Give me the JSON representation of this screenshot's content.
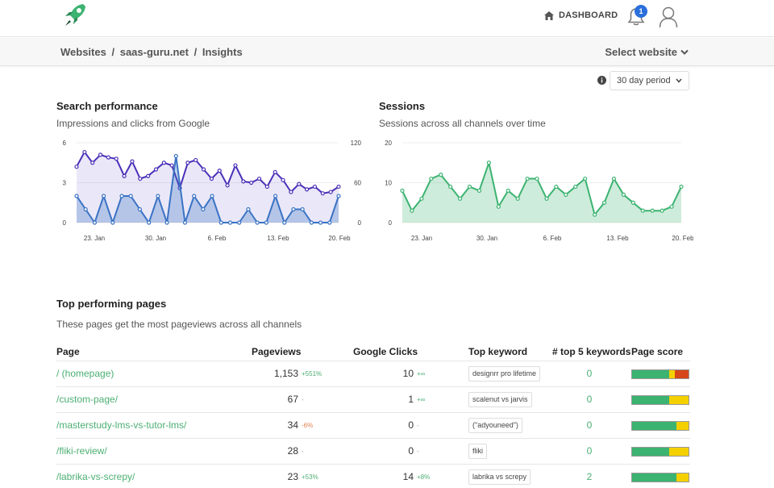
{
  "header": {
    "dashboard_label": "DASHBOARD",
    "notification_count": "1",
    "brand_color": "#3cb371"
  },
  "breadcrumb": {
    "items": [
      "Websites",
      "/",
      "saas-guru.net",
      "/",
      "Insights"
    ],
    "select_label": "Select website"
  },
  "period": {
    "selected": "30 day period"
  },
  "search_performance": {
    "title": "Search performance",
    "subtitle": "Impressions and clicks from Google"
  },
  "sessions": {
    "title": "Sessions",
    "subtitle": "Sessions across all channels over time"
  },
  "chart_data": [
    {
      "type": "line",
      "left_axis_ticks": [
        "6",
        "3",
        "0"
      ],
      "right_axis_ticks": [
        "120",
        "60",
        "0"
      ],
      "x_ticks": [
        "23. Jan",
        "30. Jan",
        "6. Feb",
        "13. Feb",
        "20. Feb"
      ],
      "ylim_left": [
        0,
        6
      ],
      "ylim_right": [
        0,
        120
      ],
      "series": [
        {
          "color": "#4b2fb8",
          "axis": "right",
          "values": [
            84,
            106,
            90,
            102,
            98,
            96,
            70,
            92,
            66,
            70,
            80,
            90,
            86,
            52,
            90,
            94,
            80,
            66,
            78,
            56,
            86,
            62,
            60,
            66,
            54,
            76,
            64,
            46,
            58,
            50,
            54,
            44,
            46,
            54
          ]
        },
        {
          "color": "#3a73c4",
          "axis": "left",
          "values": [
            2,
            1,
            0,
            2,
            0,
            2,
            2,
            1,
            0,
            2,
            0,
            5,
            0,
            2,
            1,
            2,
            0,
            0,
            0,
            1,
            0,
            0,
            2,
            0,
            1,
            1,
            0,
            0,
            0,
            2
          ]
        }
      ]
    },
    {
      "type": "area",
      "y_ticks": [
        "20",
        "10",
        "0"
      ],
      "ylim": [
        0,
        20
      ],
      "x_ticks": [
        "23. Jan",
        "30. Jan",
        "6. Feb",
        "13. Feb",
        "20. Feb"
      ],
      "series": [
        {
          "color": "#3cb371",
          "values": [
            8,
            3,
            6,
            11,
            12,
            9,
            6,
            9,
            8,
            15,
            4,
            8,
            6,
            11,
            11,
            6,
            9,
            7,
            9,
            11,
            2,
            5,
            11,
            7,
            5,
            3,
            3,
            3,
            4,
            9
          ]
        }
      ]
    }
  ],
  "top_pages": {
    "title": "Top performing pages",
    "subtitle": "These pages get the most pageviews across all channels",
    "columns": [
      "Page",
      "Pageviews",
      "Google Clicks",
      "Top keyword",
      "# top 5 keywords",
      "Page score"
    ],
    "rows": [
      {
        "page": "/ (homepage)",
        "pageviews": "1,153",
        "pv_delta": "+551%",
        "pv_delta_color": "#4caf73",
        "clicks": "10",
        "cl_delta": "+∞",
        "cl_delta_color": "#4caf73",
        "keyword": "designrr pro lifetime",
        "top5": "0",
        "score": [
          0.66,
          0.1,
          0.24
        ],
        "score_colors": [
          "#3cb371",
          "#f5d000",
          "#d7461b"
        ]
      },
      {
        "page": "/custom-page/",
        "pageviews": "67",
        "pv_delta": "-",
        "pv_delta_color": "#999",
        "clicks": "1",
        "cl_delta": "+∞",
        "cl_delta_color": "#4caf73",
        "keyword": "scalenut vs jarvis",
        "top5": "0",
        "score": [
          0.66,
          0.34
        ],
        "score_colors": [
          "#3cb371",
          "#f5d000"
        ]
      },
      {
        "page": "/masterstudy-lms-vs-tutor-lms/",
        "pageviews": "34",
        "pv_delta": "-6%",
        "pv_delta_color": "#e08050",
        "clicks": "0",
        "cl_delta": "-",
        "cl_delta_color": "#999",
        "keyword": "(\"adyouneed\")",
        "top5": "0",
        "score": [
          0.78,
          0.22
        ],
        "score_colors": [
          "#3cb371",
          "#f5d000"
        ]
      },
      {
        "page": "/fliki-review/",
        "pageviews": "28",
        "pv_delta": "-",
        "pv_delta_color": "#999",
        "clicks": "0",
        "cl_delta": "-",
        "cl_delta_color": "#999",
        "keyword": "fliki",
        "top5": "0",
        "score": [
          0.66,
          0.34
        ],
        "score_colors": [
          "#3cb371",
          "#f5d000"
        ]
      },
      {
        "page": "/labrika-vs-screpy/",
        "pageviews": "23",
        "pv_delta": "+53%",
        "pv_delta_color": "#4caf73",
        "clicks": "14",
        "cl_delta": "+8%",
        "cl_delta_color": "#4caf73",
        "keyword": "labrika vs screpy",
        "top5": "2",
        "score": [
          0.78,
          0.22
        ],
        "score_colors": [
          "#3cb371",
          "#f5d000"
        ]
      }
    ]
  }
}
